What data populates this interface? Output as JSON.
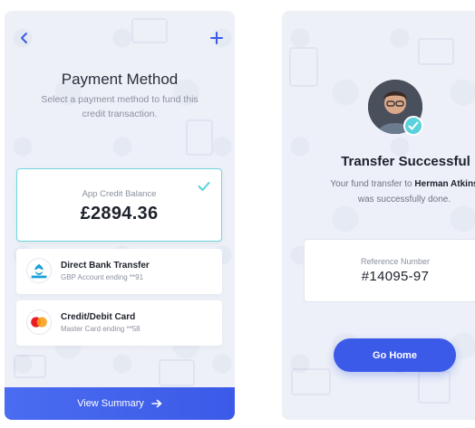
{
  "payment_screen": {
    "title": "Payment Method",
    "subtitle": "Select a payment method to fund this credit transaction.",
    "balance": {
      "label": "App Credit Balance",
      "value": "£2894.36"
    },
    "methods": [
      {
        "name": "Direct Bank Transfer",
        "detail": "GBP Account ending **91",
        "logo": "barclays-logo",
        "logo_text": "BARCLAYS"
      },
      {
        "name": "Credit/Debit Card",
        "detail": "Master Card ending **58",
        "logo": "mastercard-logo",
        "logo_text": "MasterCard"
      }
    ],
    "summary_button": "View Summary",
    "icons": {
      "back": "chevron-left-icon",
      "add": "plus-icon",
      "selected": "check-icon",
      "next": "arrow-right-icon"
    }
  },
  "success_screen": {
    "title": "Transfer Successful",
    "message_prefix": "Your fund transfer to",
    "recipient": "Herman Atkins",
    "message_suffix": "was successfully done.",
    "reference": {
      "label": "Reference Number",
      "value": "#14095-97"
    },
    "home_button": "Go Home",
    "icons": {
      "verified": "check-badge-icon",
      "avatar": "user-avatar"
    }
  },
  "colors": {
    "accent": "#3c5ae8",
    "teal": "#5ad1dc",
    "background": "#f4f6fb",
    "text_dark": "#1e222c",
    "text_muted": "#8b90a0"
  }
}
